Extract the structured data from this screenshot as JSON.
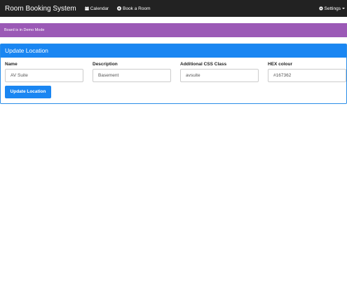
{
  "navbar": {
    "brand": "Room Booking System",
    "calendar_label": "Calendar",
    "book_label": "Book a Room",
    "settings_label": "Settings"
  },
  "alert": {
    "text": "Board is in Demo Mode"
  },
  "panel": {
    "title": "Update Location",
    "fields": [
      {
        "label": "Name",
        "value": "AV Suite"
      },
      {
        "label": "Description",
        "value": "Basement"
      },
      {
        "label": "Additional CSS Class",
        "value": "avsuite"
      },
      {
        "label": "HEX colour",
        "value": "#167362"
      }
    ],
    "submit_label": "Update Location"
  },
  "colors": {
    "navbar": "#222222",
    "alert": "#9b59b6",
    "primary": "#1a86f2"
  }
}
